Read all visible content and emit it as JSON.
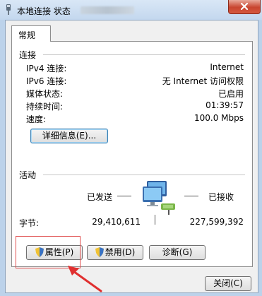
{
  "window": {
    "title": "本地连接 状态"
  },
  "tab": {
    "label": "常规"
  },
  "connection": {
    "heading": "连接",
    "rows": [
      {
        "label": "IPv4 连接:",
        "value": "Internet"
      },
      {
        "label": "IPv6 连接:",
        "value": "无 Internet 访问权限"
      },
      {
        "label": "媒体状态:",
        "value": "已启用"
      },
      {
        "label": "持续时间:",
        "value": "01:39:57"
      },
      {
        "label": "速度:",
        "value": "100.0 Mbps"
      }
    ],
    "details_button": "详细信息(E)..."
  },
  "activity": {
    "heading": "活动",
    "sent_label": "已发送",
    "received_label": "已接收",
    "bytes_label": "字节:",
    "bytes_sent": "29,410,611",
    "bytes_received": "227,599,392"
  },
  "buttons": {
    "properties": "属性(P)",
    "disable": "禁用(D)",
    "diagnose": "诊断(G)",
    "close": "关闭(C)"
  },
  "icons": [
    "network-icon",
    "close-icon",
    "shield-icon",
    "network-computers-icon"
  ],
  "colors": {
    "highlight_box": "#e05050",
    "accent_border": "#3c7fb1"
  }
}
